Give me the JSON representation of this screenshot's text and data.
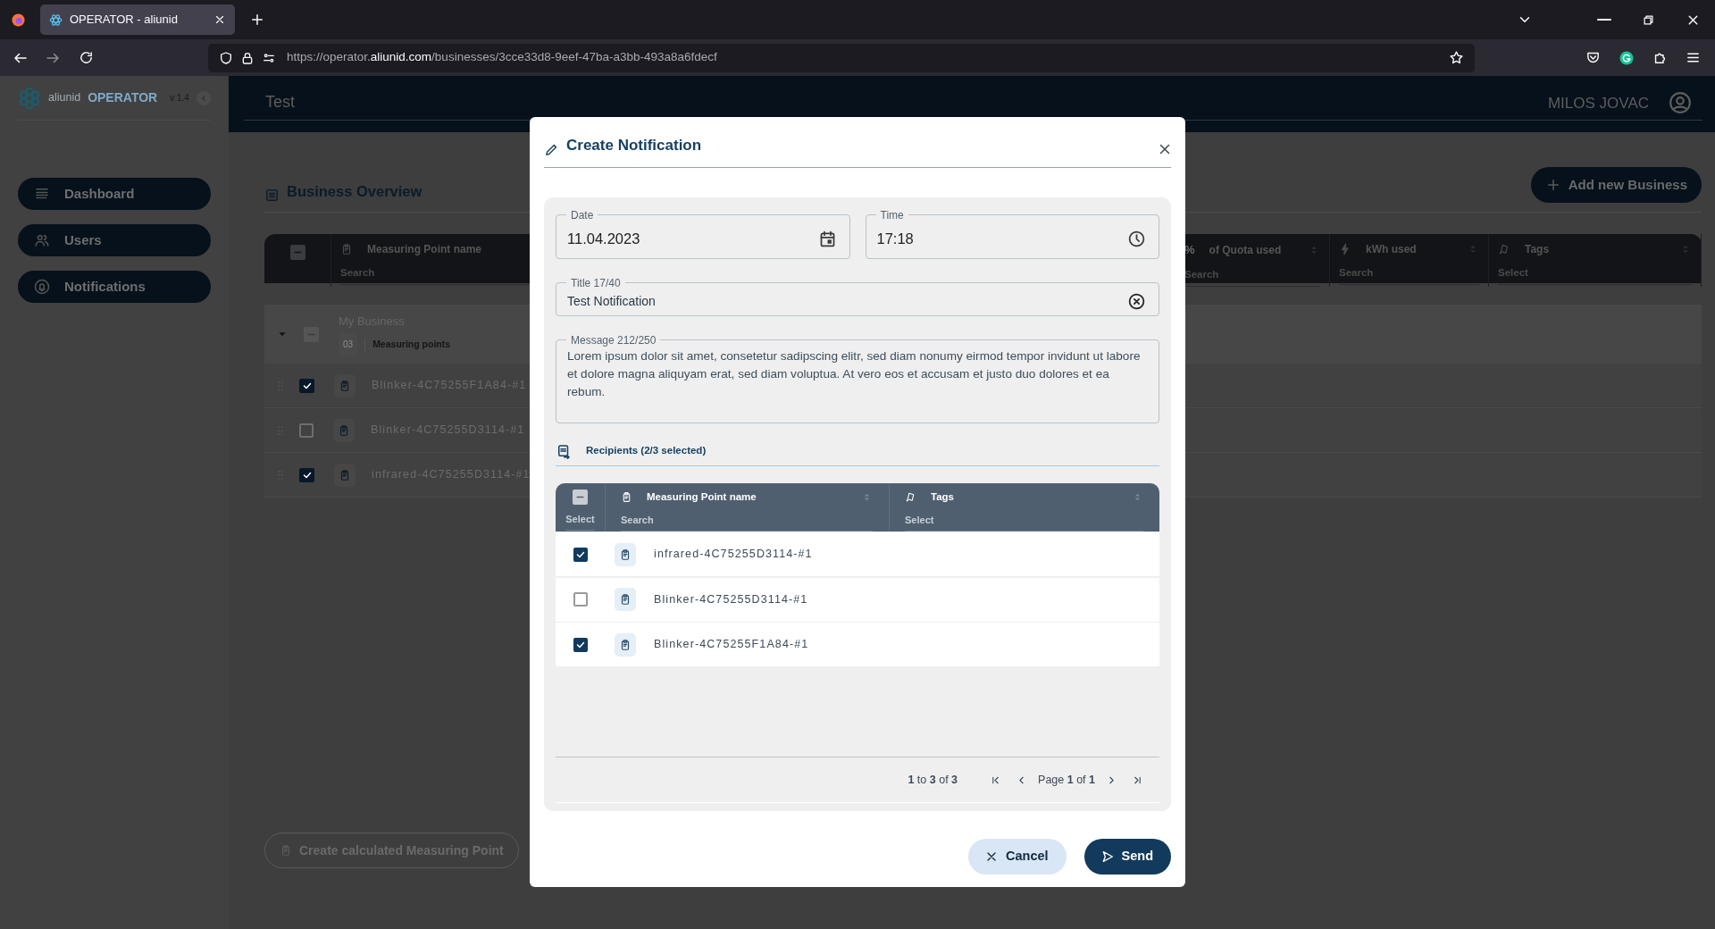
{
  "browser": {
    "tab_title": "OPERATOR - aliunid",
    "url_scheme": "https://operator.",
    "url_domain": "aliunid.com",
    "url_path": "/businesses/3cce33d8-9eef-47ba-a3bb-493a8a6fdecf"
  },
  "sidebar": {
    "brand_prefix": "aliunid",
    "brand_name": "OPERATOR",
    "version": "v 1.4",
    "items": [
      {
        "label": "Dashboard",
        "kind": "dashboard"
      },
      {
        "label": "Users",
        "kind": "users"
      },
      {
        "label": "Notifications",
        "kind": "notifications"
      }
    ]
  },
  "header": {
    "title": "Test",
    "user": "MILOS JOVAC"
  },
  "overview": {
    "title": "Business Overview",
    "add_button": "Add new Business",
    "table": {
      "select_indeterminate": true,
      "columns": [
        {
          "label": "Measuring Point name",
          "filter": "Search",
          "kind": "name"
        },
        {
          "label": "of Quota used",
          "filter": "Search",
          "kind": "percent",
          "symbol": "%"
        },
        {
          "label": "kWh used",
          "filter": "Search",
          "kind": "energy"
        },
        {
          "label": "Tags",
          "filter": "Select",
          "kind": "tags"
        }
      ],
      "group": {
        "name": "My Business",
        "count": "03",
        "count_label": "Measuring points",
        "expanded": true,
        "indeterminate": true
      },
      "rows": [
        {
          "name": "Blinker-4C75255F1A84-#1",
          "checked": true
        },
        {
          "name": "Blinker-4C75255D3114-#1",
          "checked": false
        },
        {
          "name": "infrared-4C75255D3114-#1",
          "checked": true
        }
      ]
    },
    "bottom_button": "Create calculated Measuring Point"
  },
  "modal": {
    "title": "Create Notification",
    "date": {
      "label": "Date",
      "value": "11.04.2023"
    },
    "time": {
      "label": "Time",
      "value": "17:18"
    },
    "title_field": {
      "label": "Title 17/40",
      "value": "Test Notification"
    },
    "message": {
      "label": "Message 212/250",
      "value": "Lorem ipsum dolor sit amet, consetetur sadipscing elitr, sed diam nonumy eirmod tempor invidunt ut labore et dolore magna aliquyam erat, sed diam voluptua. At vero eos et accusam et justo duo dolores et ea rebum."
    },
    "recipients_label": "Recipients (2/3 selected)",
    "table": {
      "select_label": "Select",
      "select_indeterminate": true,
      "columns": [
        {
          "label": "Measuring Point name",
          "filter": "Search",
          "kind": "name"
        },
        {
          "label": "Tags",
          "filter": "Select",
          "kind": "tags"
        }
      ],
      "rows": [
        {
          "name": "infrared-4C75255D3114-#1",
          "checked": true
        },
        {
          "name": "Blinker-4C75255D3114-#1",
          "checked": false
        },
        {
          "name": "Blinker-4C75255F1A84-#1",
          "checked": true
        }
      ]
    },
    "range": "**1** to **3** of **3**",
    "page": "Page **1** of **1**",
    "buttons": [
      {
        "label": "Cancel",
        "kind": "cancel"
      },
      {
        "label": "Send",
        "kind": "send"
      }
    ]
  }
}
